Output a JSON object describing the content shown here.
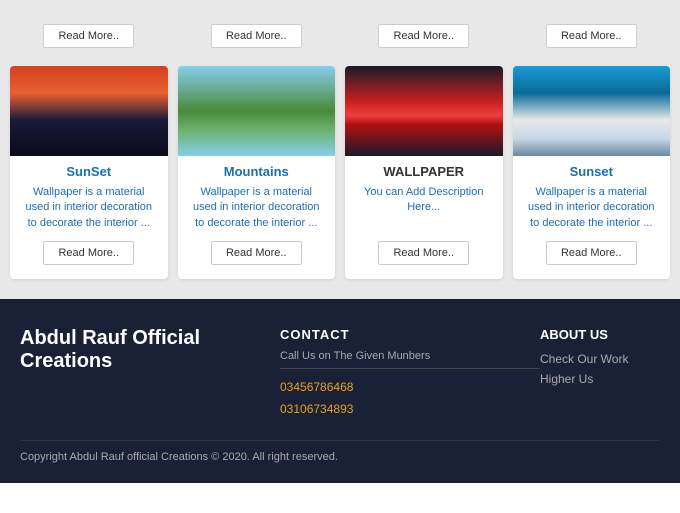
{
  "top_row": {
    "buttons": [
      "Read More..",
      "Read More..",
      "Read More..",
      "Read More.."
    ]
  },
  "cards": [
    {
      "id": "sunset",
      "title": "SunSet",
      "title_style": "blue",
      "description": "Wallpaper is a material used in interior decoration to decorate the interior ...",
      "desc_style": "blue",
      "img_class": "img-sunset1",
      "btn_label": "Read More.."
    },
    {
      "id": "mountains",
      "title": "Mountains",
      "title_style": "blue",
      "description": "Wallpaper is a material used in interior decoration to decorate the interior ...",
      "desc_style": "blue",
      "img_class": "img-mountains",
      "btn_label": "Read More.."
    },
    {
      "id": "wallpaper",
      "title": "WALLPAPER",
      "title_style": "dark",
      "description": "You can Add Description Here...",
      "desc_style": "blue",
      "img_class": "img-wallpaper",
      "btn_label": "Read More.."
    },
    {
      "id": "sunset2",
      "title": "Sunset",
      "title_style": "blue",
      "description": "Wallpaper is a material used in interior decoration to decorate the interior ...",
      "desc_style": "blue",
      "img_class": "img-sunset2",
      "btn_label": "Read More.."
    }
  ],
  "footer": {
    "brand": "Abdul Rauf Official Creations",
    "contact_title": "CONTACT",
    "contact_subtitle": "Call Us on The Given Munbers",
    "phones": [
      "03456786468",
      "03106734893"
    ],
    "about_title": "ABOUT US",
    "links": [
      "Check Our Work",
      "Higher Us"
    ],
    "copyright": "Copyright Abdul Rauf official Creations © 2020. All right reserved."
  }
}
